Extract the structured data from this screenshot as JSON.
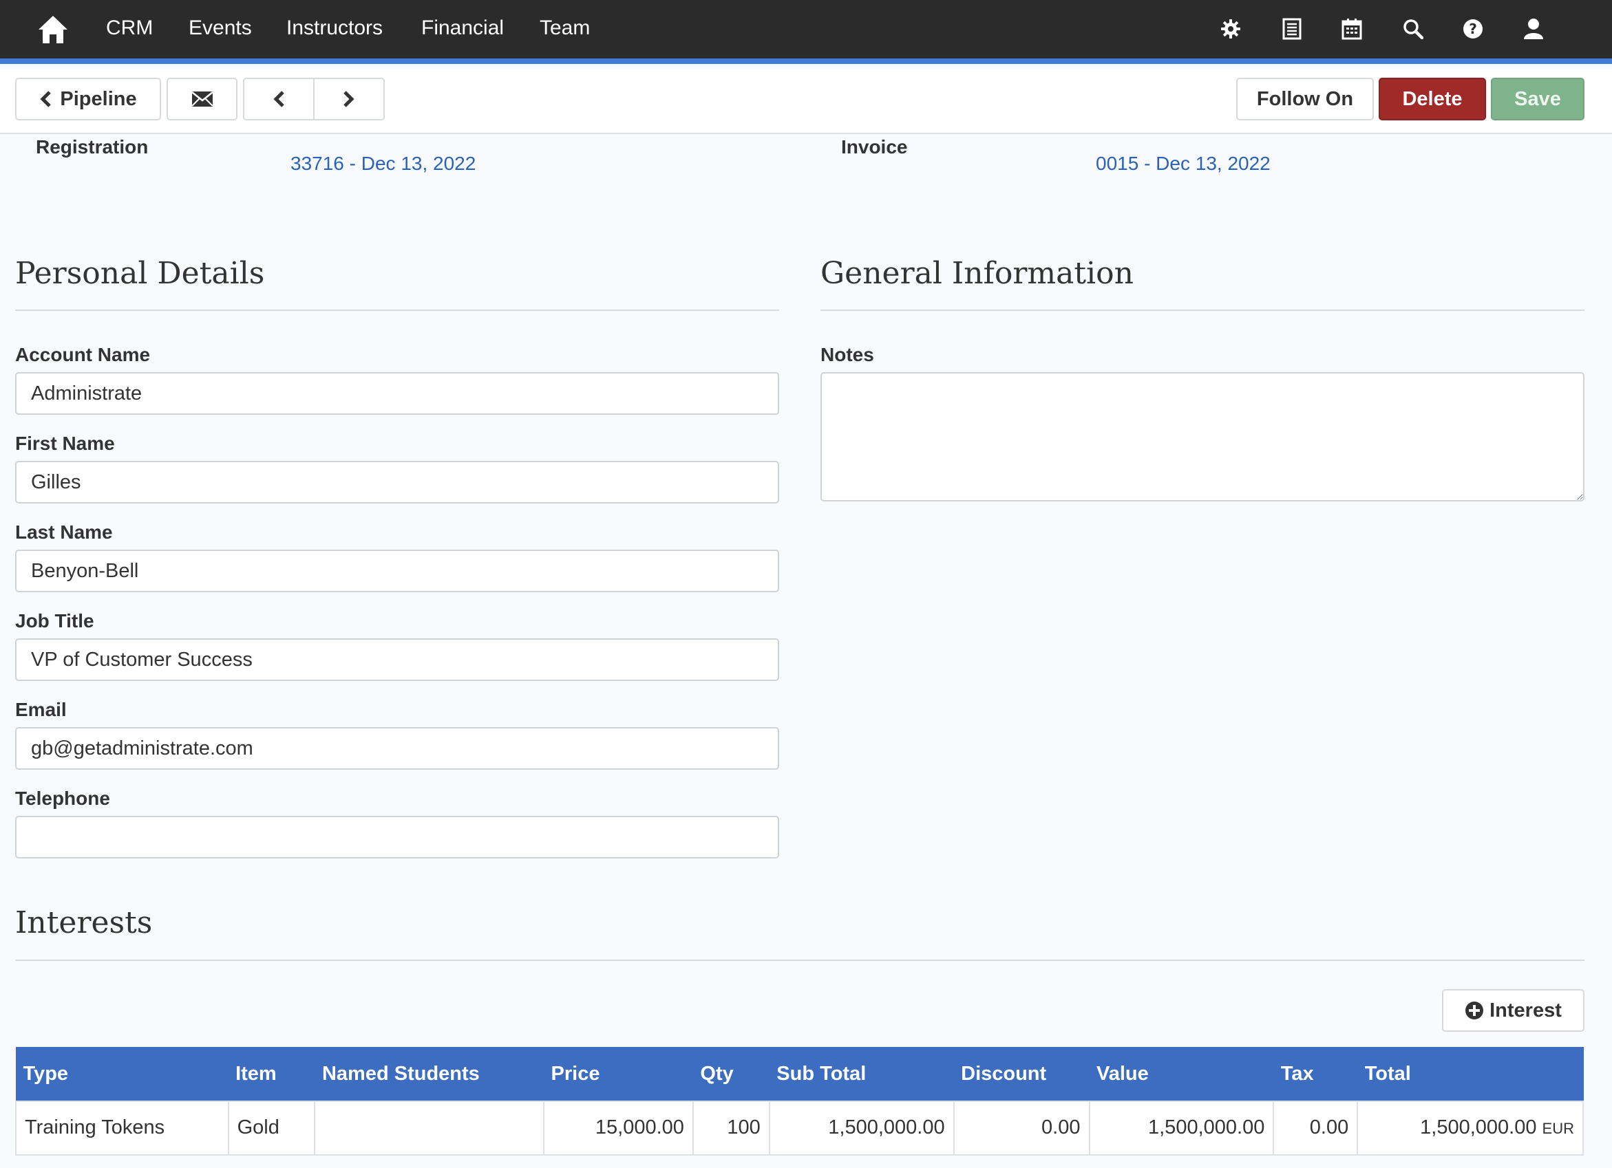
{
  "topnav": {
    "items": [
      "CRM",
      "Events",
      "Instructors",
      "Financial",
      "Team"
    ],
    "icons": [
      "gear-icon",
      "list-icon",
      "calendar-icon",
      "search-icon",
      "help-icon",
      "user-icon"
    ]
  },
  "toolbar": {
    "pipeline_label": "Pipeline",
    "follow_on_label": "Follow On",
    "delete_label": "Delete",
    "save_label": "Save"
  },
  "meta": {
    "registration_label": "Registration",
    "registration_value": "33716 - Dec 13, 2022",
    "invoice_label": "Invoice",
    "invoice_value": "0015 - Dec 13, 2022"
  },
  "personal": {
    "title": "Personal Details",
    "account_name_label": "Account Name",
    "account_name": "Administrate",
    "first_name_label": "First Name",
    "first_name": "Gilles",
    "last_name_label": "Last Name",
    "last_name": "Benyon-Bell",
    "job_title_label": "Job Title",
    "job_title": "VP of Customer Success",
    "email_label": "Email",
    "email": "gb@getadministrate.com",
    "telephone_label": "Telephone",
    "telephone": ""
  },
  "general": {
    "title": "General Information",
    "notes_label": "Notes",
    "notes": ""
  },
  "interests": {
    "title": "Interests",
    "add_label": "Interest",
    "columns": [
      "Type",
      "Item",
      "Named Students",
      "Price",
      "Qty",
      "Sub Total",
      "Discount",
      "Value",
      "Tax",
      "Total"
    ],
    "rows": [
      {
        "type": "Training Tokens",
        "item": "Gold",
        "named_students": "",
        "price": "15,000.00",
        "qty": "100",
        "sub_total": "1,500,000.00",
        "discount": "0.00",
        "value": "1,500,000.00",
        "tax": "0.00",
        "total": "1,500,000.00",
        "currency": "EUR"
      }
    ]
  },
  "colors": {
    "nav_bg": "#2b2b2b",
    "nav_accent": "#3f7bd9",
    "delete": "#a02a28",
    "save": "#7fb38c",
    "link": "#2a62b8",
    "table_header": "#3c6dc0"
  }
}
